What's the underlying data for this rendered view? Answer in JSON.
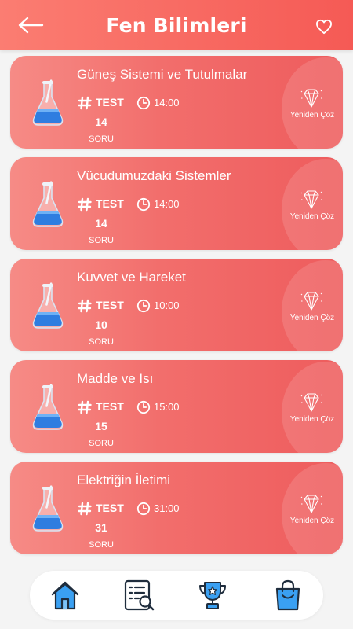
{
  "header": {
    "title": "Fen Bilimleri",
    "back_icon": "arrow-left-icon",
    "favorite_icon": "heart-outline-icon",
    "color_start": "#fb7d72",
    "color_end": "#f55a55"
  },
  "cards": [
    {
      "topic": "Güneş Sistemi ve Tutulmalar",
      "test_label": "TEST",
      "question_count": "14",
      "question_unit": "SORU",
      "time": "14:00",
      "action": "Yeniden Çöz"
    },
    {
      "topic": "Vücudumuzdaki Sistemler",
      "test_label": "TEST",
      "question_count": "14",
      "question_unit": "SORU",
      "time": "14:00",
      "action": "Yeniden Çöz"
    },
    {
      "topic": "Kuvvet ve Hareket",
      "test_label": "TEST",
      "question_count": "10",
      "question_unit": "SORU",
      "time": "10:00",
      "action": "Yeniden Çöz"
    },
    {
      "topic": "Madde ve Isı",
      "test_label": "TEST",
      "question_count": "15",
      "question_unit": "SORU",
      "time": "15:00",
      "action": "Yeniden Çöz"
    },
    {
      "topic": "Elektriğin İletimi",
      "test_label": "TEST",
      "question_count": "31",
      "question_unit": "SORU",
      "time": "31:00",
      "action": "Yeniden Çöz"
    }
  ],
  "bottom_nav": {
    "items": [
      {
        "icon": "home-icon"
      },
      {
        "icon": "list-search-icon"
      },
      {
        "icon": "trophy-icon"
      },
      {
        "icon": "shopping-bag-icon"
      }
    ]
  },
  "colors": {
    "card_start": "#f68b86",
    "card_end": "#ee5c5d",
    "nav_icon_blue": "#3aa0f2",
    "background": "#f4f4f4"
  }
}
